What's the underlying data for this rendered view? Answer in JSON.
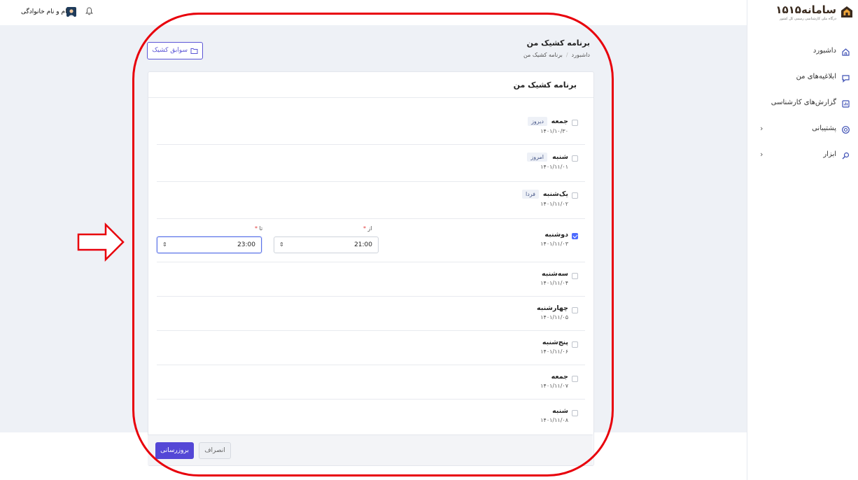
{
  "logo": {
    "title": "سامانه۱۵۱۵",
    "subtitle": "درگاه ملی کارشناسی رسمی کل کشور"
  },
  "sidebar": {
    "items": [
      {
        "label": "داشبورد",
        "icon": "home-icon",
        "has_submenu": false
      },
      {
        "label": "ابلاغیه‌های من",
        "icon": "chat-icon",
        "has_submenu": false
      },
      {
        "label": "گزارش‌های کارشناسی",
        "icon": "report-icon",
        "has_submenu": false
      },
      {
        "label": "پشتیبانی",
        "icon": "support-icon",
        "has_submenu": true
      },
      {
        "label": "ابزار",
        "icon": "tools-icon",
        "has_submenu": true
      }
    ]
  },
  "topbar": {
    "user_name": "نام و نام خانوادگی"
  },
  "header": {
    "title": "برنامه کشیک من",
    "breadcrumb": [
      "داشبورد",
      "برنامه کشیک من"
    ],
    "history_button": "سوابق کشیک"
  },
  "card": {
    "title": "برنامه کشیک من",
    "from_label": "از",
    "to_label": "تا",
    "required_mark": "*",
    "days": [
      {
        "name": "جمعه",
        "badge": "دیروز",
        "date": "۱۴۰۱/۱۰/۳۰",
        "checked": false
      },
      {
        "name": "شنبه",
        "badge": "امروز",
        "date": "۱۴۰۱/۱۱/۰۱",
        "checked": false
      },
      {
        "name": "یک‌شنبه",
        "badge": "فردا",
        "date": "۱۴۰۱/۱۱/۰۲",
        "checked": false
      },
      {
        "name": "دوشنبه",
        "badge": "",
        "date": "۱۴۰۱/۱۱/۰۳",
        "checked": true,
        "from": "21:00",
        "to": "23:00"
      },
      {
        "name": "سه‌شنبه",
        "badge": "",
        "date": "۱۴۰۱/۱۱/۰۴",
        "checked": false
      },
      {
        "name": "چهارشنبه",
        "badge": "",
        "date": "۱۴۰۱/۱۱/۰۵",
        "checked": false
      },
      {
        "name": "پنج‌شنبه",
        "badge": "",
        "date": "۱۴۰۱/۱۱/۰۶",
        "checked": false
      },
      {
        "name": "جمعه",
        "badge": "",
        "date": "۱۴۰۱/۱۱/۰۷",
        "checked": false
      },
      {
        "name": "شنبه",
        "badge": "",
        "date": "۱۴۰۱/۱۱/۰۸",
        "checked": false
      }
    ]
  },
  "footer": {
    "update_button": "بروزرسانی",
    "cancel_button": "انصراف"
  },
  "colors": {
    "accent": "#5447d6",
    "annotation": "#e8000b",
    "page_bg": "#eef1f6"
  }
}
